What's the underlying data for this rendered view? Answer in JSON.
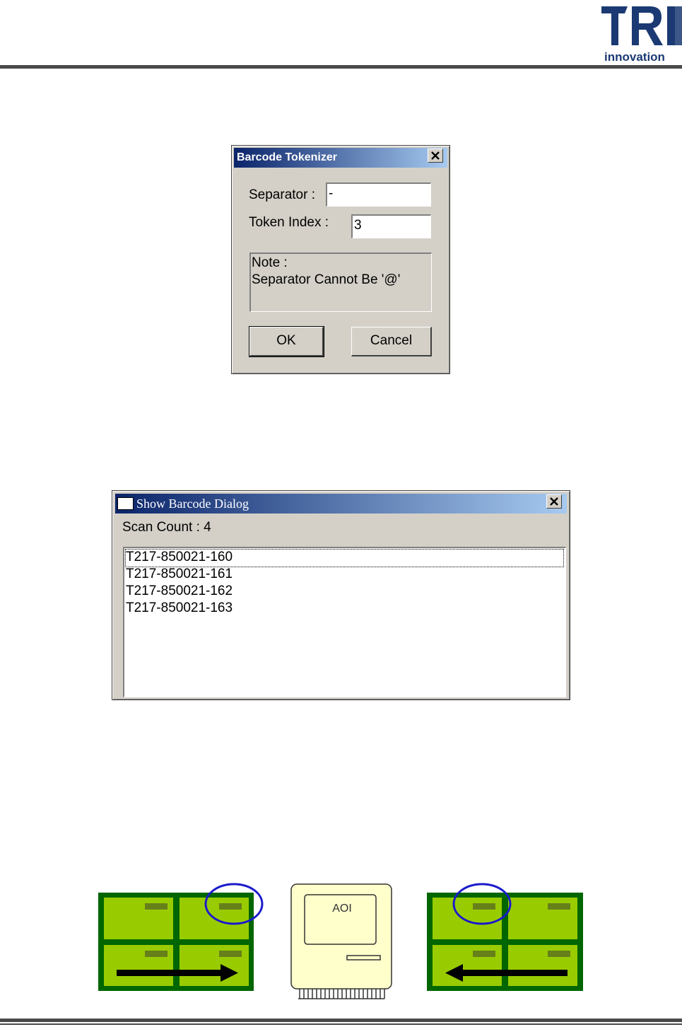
{
  "logo": {
    "mark": "TRI",
    "text": "innovation"
  },
  "tokenizer_dialog": {
    "title": "Barcode Tokenizer",
    "separator_label": "Separator :",
    "separator_value": "-",
    "token_index_label": "Token Index :",
    "token_index_value": "3",
    "note_line1": "Note :",
    "note_line2": "Separator Cannot Be '@'",
    "ok_label": "OK",
    "cancel_label": "Cancel"
  },
  "barcode_dialog": {
    "title": "Show Barcode Dialog",
    "scan_count_label": "Scan Count :  4",
    "items": [
      "T217-850021-160",
      "T217-850021-161",
      "T217-850021-162",
      "T217-850021-163"
    ]
  },
  "diagram": {
    "aoi_label": "AOI",
    "colors": {
      "board_fill": "#99cc00",
      "board_border": "#006600",
      "circle": "#1a1acc",
      "aoi_fill": "#ffffcc"
    }
  }
}
